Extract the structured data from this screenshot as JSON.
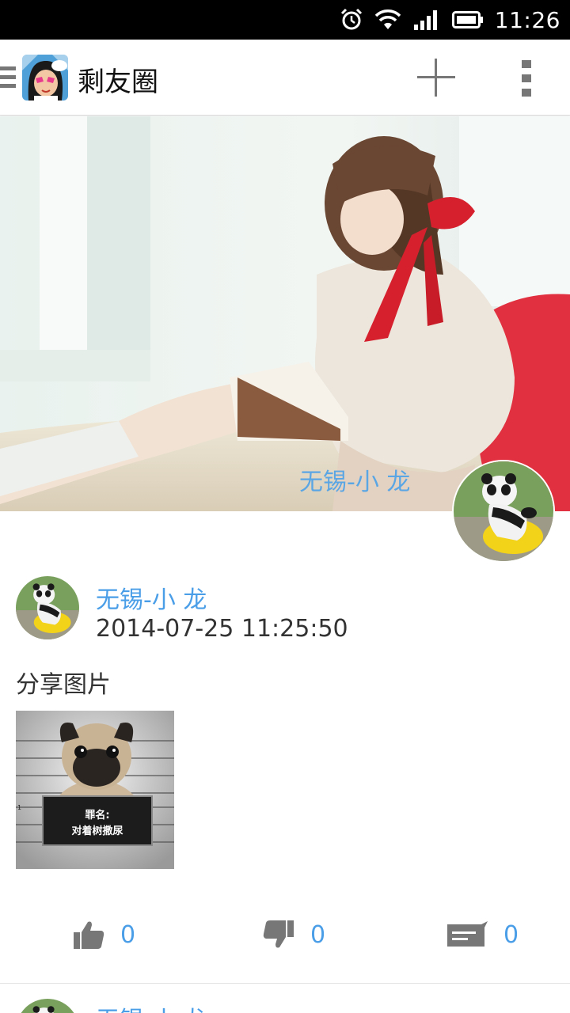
{
  "status_bar": {
    "time": "11:26",
    "icons": [
      "alarm-icon",
      "wifi-icon",
      "signal-icon",
      "battery-icon"
    ]
  },
  "action_bar": {
    "title": "剩友圈",
    "icons": [
      "menu-icon",
      "app-logo",
      "add-icon",
      "overflow-menu-icon"
    ]
  },
  "cover": {
    "username": "无锡-小 龙"
  },
  "posts": [
    {
      "username": "无锡-小 龙",
      "timestamp": "2014-07-25 11:25:50",
      "text": "分享图片",
      "image_text": {
        "line1": "罪名:",
        "line2": "对着树撒尿",
        "ruler_mark": "1"
      },
      "likes": "0",
      "dislikes": "0",
      "comments": "0"
    },
    {
      "username": "无锡-小 龙"
    }
  ],
  "colors": {
    "accent_blue": "#4a9ee8",
    "icon_gray": "#777777"
  }
}
